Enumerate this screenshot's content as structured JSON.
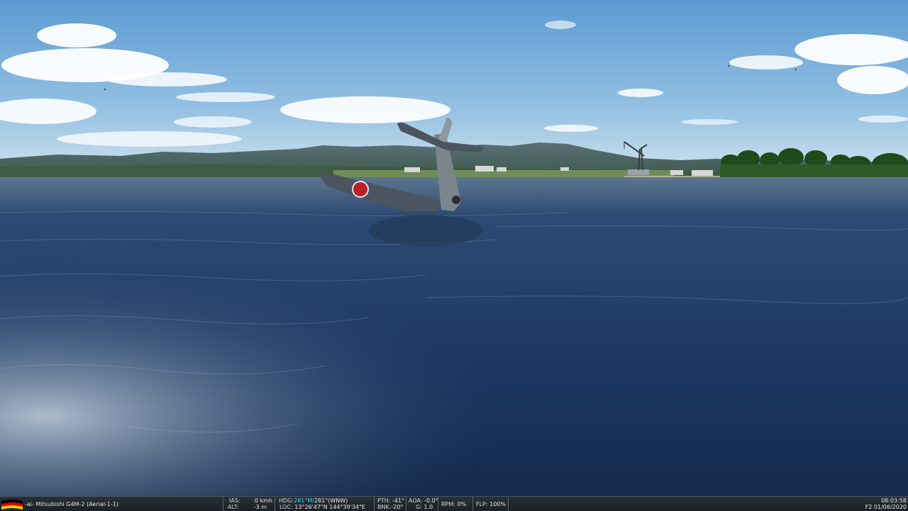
{
  "hud": {
    "aircraft": "-ai- Mitsubishi G4M-2 (Aerial-1-1)",
    "ias_label": "IAS:",
    "ias_value": "0 kmh",
    "alt_label": "ALT:",
    "alt_value": "-3 m",
    "hdg_label": "HDG:",
    "hdg_mag": "281°M/",
    "hdg_true": "281°(WNW)",
    "loc_label": "LOC:",
    "loc_value": "13°26'47\"N 144°39'34\"E",
    "pth_label": "PTH:",
    "pth_value": "-41°",
    "bnk_label": "BNK:",
    "bnk_value": "-20°",
    "aoa_label": "AOA:",
    "aoa_value": "-0.0°",
    "g_label": "G:",
    "g_value": "1.0",
    "rpm_label": "RPM:",
    "rpm_value": "0%",
    "flp_label": "FLP:",
    "flp_value": "100%",
    "time": "08:03:58",
    "date": "F2 01/06/2020"
  },
  "colors": {
    "sky_top": "#5f9fd4",
    "sky_horizon": "#c4dced",
    "water": "#1c3a63",
    "hud_bg": "#1f252c",
    "hud_accent": "#34d6ff"
  }
}
